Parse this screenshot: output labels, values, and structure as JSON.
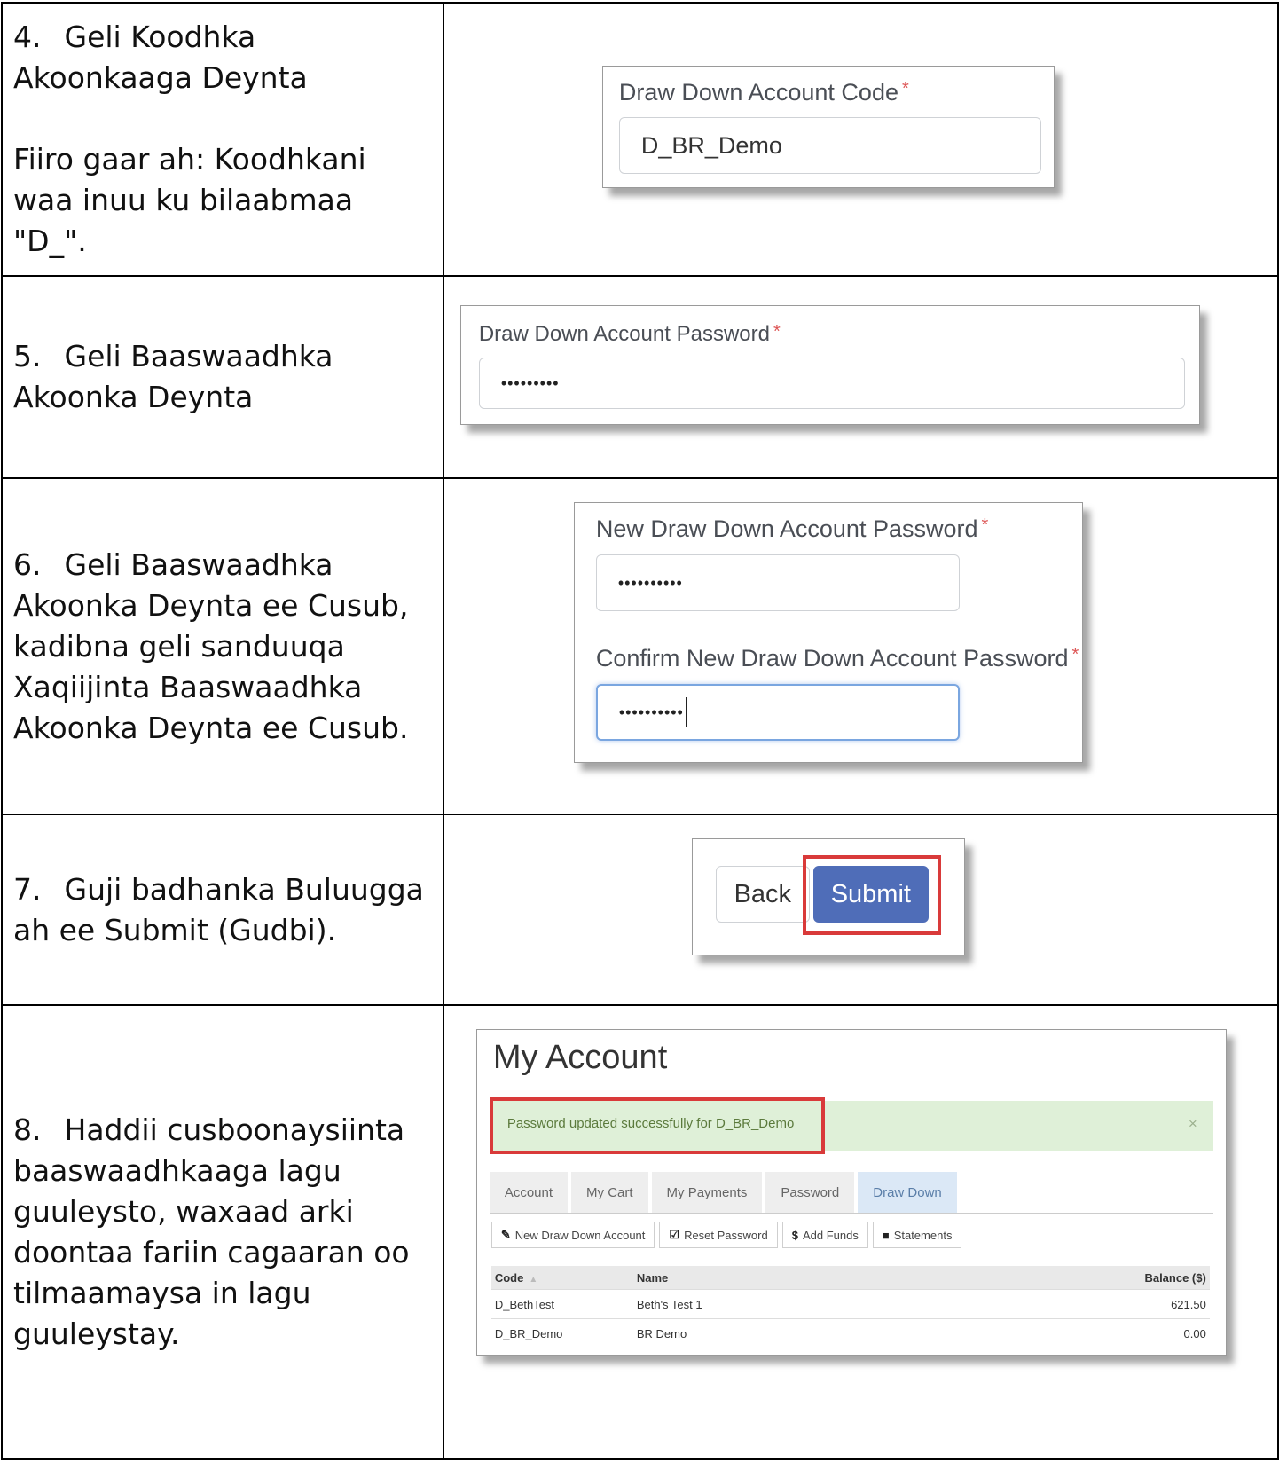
{
  "steps": [
    {
      "text": [
        "4.\tGeli Koodhka Akoonkaaga Deynta",
        "Fiiro gaar ah: Koodhkani waa inuu ku bilaabmaa \"D_\"."
      ],
      "num": "4.",
      "line1": "Geli Koodhka Akoonkaaga Deynta",
      "note": "Fiiro gaar ah: Koodhkani waa inuu ku bilaabmaa \"D_\".",
      "label": "Draw Down Account Code",
      "required": "*",
      "value": "D_BR_Demo"
    },
    {
      "num": "5.",
      "line1": "Geli Baaswaadhka Akoonka Deynta",
      "label": "Draw Down Account Password",
      "required": "*",
      "value": "•••••••••"
    },
    {
      "num": "6.",
      "line1": "Geli Baaswaadhka Akoonka Deynta ee Cusub, kadibna geli sanduuqa Xaqiijinta Baaswaadhka Akoonka Deynta ee Cusub.",
      "label1": "New Draw Down Account Password",
      "value1": "••••••••••",
      "label2": "Confirm New Draw Down Account Password",
      "value2": "••••••••••",
      "required": "*"
    },
    {
      "num": "7.",
      "line1": "Guji badhanka Buluugga ah ee Submit (Gudbi).",
      "back": "Back",
      "submit": "Submit"
    },
    {
      "num": "8.",
      "line1": "Haddii cusboonaysiinta baaswaadhkaaga lagu guuleysto, waxaad arki doontaa fariin cagaaran oo tilmaamaysa in lagu guuleystay."
    }
  ],
  "my_account": {
    "title": "My Account",
    "alert": "Password updated successfully for D_BR_Demo",
    "alert_close": "×",
    "tabs": [
      "Account",
      "My Cart",
      "My Payments",
      "Password",
      "Draw Down"
    ],
    "active_tab": "Draw Down",
    "toolbar": [
      {
        "icon": "pencil-icon",
        "glyph": "✎",
        "label": "New Draw Down Account"
      },
      {
        "icon": "edit-icon",
        "glyph": "☑",
        "label": "Reset Password"
      },
      {
        "icon": "dollar-icon",
        "glyph": "$",
        "label": "Add Funds"
      },
      {
        "icon": "folder-icon",
        "glyph": "■",
        "label": "Statements"
      }
    ],
    "columns": [
      "Code",
      "Name",
      "Balance ($)"
    ],
    "rows": [
      [
        "D_BethTest",
        "Beth's Test 1",
        "621.50"
      ],
      [
        "D_BR_Demo",
        "BR Demo",
        "0.00"
      ]
    ]
  }
}
